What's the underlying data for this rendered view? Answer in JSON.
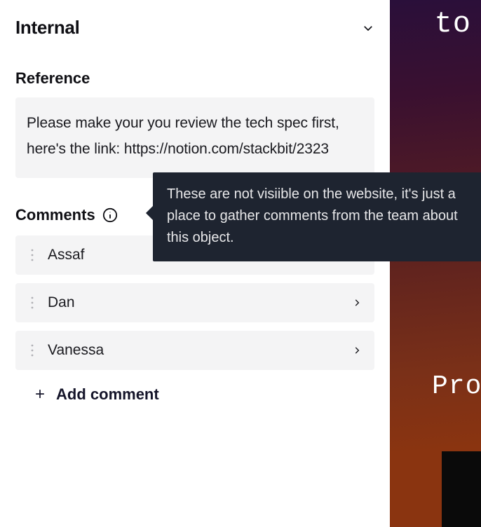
{
  "section": {
    "title": "Internal"
  },
  "reference": {
    "label": "Reference",
    "text": "Please make your you review the tech spec first, here's the link: https://notion.com/stackbit/2323"
  },
  "comments": {
    "label": "Comments",
    "tooltip": "These are not visiible on the website, it's just a place to gather comments from the team about this object.",
    "add_label": "Add comment",
    "items": [
      {
        "name": "Assaf"
      },
      {
        "name": "Dan"
      },
      {
        "name": "Vanessa"
      }
    ]
  },
  "preview": {
    "word1": "to",
    "word2": "Pro"
  }
}
